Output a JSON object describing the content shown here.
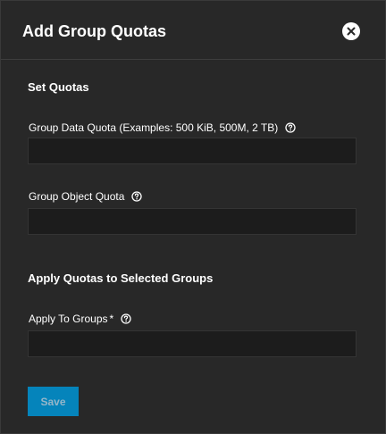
{
  "dialog": {
    "title": "Add Group Quotas"
  },
  "sections": {
    "set_quotas": "Set Quotas",
    "apply_quotas": "Apply Quotas to Selected Groups"
  },
  "fields": {
    "data_quota": {
      "label": "Group Data Quota (Examples: 500 KiB, 500M, 2 TB)",
      "value": "",
      "placeholder": ""
    },
    "object_quota": {
      "label": "Group Object Quota",
      "value": "",
      "placeholder": ""
    },
    "apply_to_groups": {
      "label": "Apply To Groups",
      "required_marker": "*",
      "value": "",
      "placeholder": ""
    }
  },
  "actions": {
    "save_label": "Save"
  },
  "icons": {
    "close": "close-circle-icon",
    "help": "help-circle-icon"
  },
  "colors": {
    "background": "#282828",
    "input_background": "#1c1c1c",
    "primary_button": "#0095d5",
    "text": "#ffffff"
  }
}
